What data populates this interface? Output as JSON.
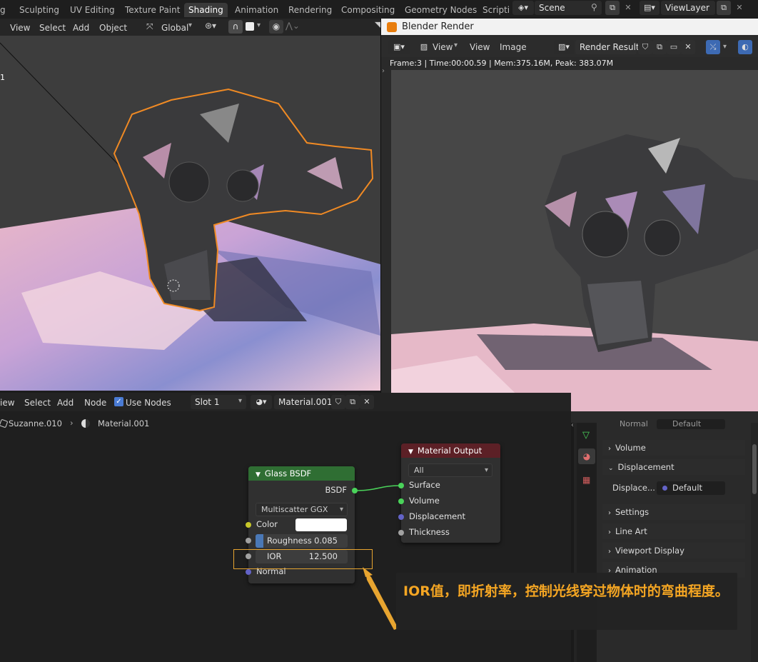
{
  "topbar": {
    "tabs": [
      "g",
      "Sculpting",
      "UV Editing",
      "Texture Paint",
      "Shading",
      "Animation",
      "Rendering",
      "Compositing",
      "Geometry Nodes",
      "Scripti"
    ],
    "active_tab": "Shading",
    "scene": "Scene",
    "view_layer": "ViewLayer"
  },
  "viewport_header": {
    "menus": [
      "View",
      "Select",
      "Add",
      "Object"
    ],
    "orientation": "Global",
    "overlay_digit": "1"
  },
  "render_window": {
    "title": "Blender Render",
    "menus": [
      "View",
      "View",
      "Image"
    ],
    "image_name": "Render Result",
    "stats": "Frame:3 | Time:00:00.59 | Mem:375.16M, Peak: 383.07M"
  },
  "node_header": {
    "menus": [
      "iew",
      "Select",
      "Add",
      "Node"
    ],
    "use_nodes_label": "Use Nodes",
    "slot": "Slot 1",
    "material": "Material.001",
    "breadcrumb_object": "Suzanne.010",
    "breadcrumb_material": "Material.001"
  },
  "glass_node": {
    "title": "Glass BSDF",
    "output": "BSDF",
    "distribution": "Multiscatter GGX",
    "color_label": "Color",
    "roughness_label": "Roughness",
    "roughness_value": "0.085",
    "roughness_fraction": 0.085,
    "ior_label": "IOR",
    "ior_value": "12.500",
    "normal_label": "Normal"
  },
  "output_node": {
    "title": "Material Output",
    "target": "All",
    "inputs": [
      "Surface",
      "Volume",
      "Displacement",
      "Thickness"
    ]
  },
  "properties": {
    "normal_label": "Normal",
    "normal_value": "Default",
    "volume": "Volume",
    "displacement": "Displacement",
    "displace_label": "Displace...",
    "displace_value": "Default",
    "settings": "Settings",
    "line_art": "Line Art",
    "viewport_display": "Viewport Display",
    "animation": "Animation"
  },
  "annotation": {
    "text": "IOR值，即折射率，控制光线穿过物体时的弯曲程度。"
  },
  "colors": {
    "accent_orange": "#e8a530",
    "glass_header": "#2f6e33",
    "output_header": "#5c2026",
    "socket_yellow": "#c7c729",
    "socket_gray": "#a1a1a1",
    "socket_purple": "#6363c7",
    "socket_green": "#4ad35a"
  }
}
